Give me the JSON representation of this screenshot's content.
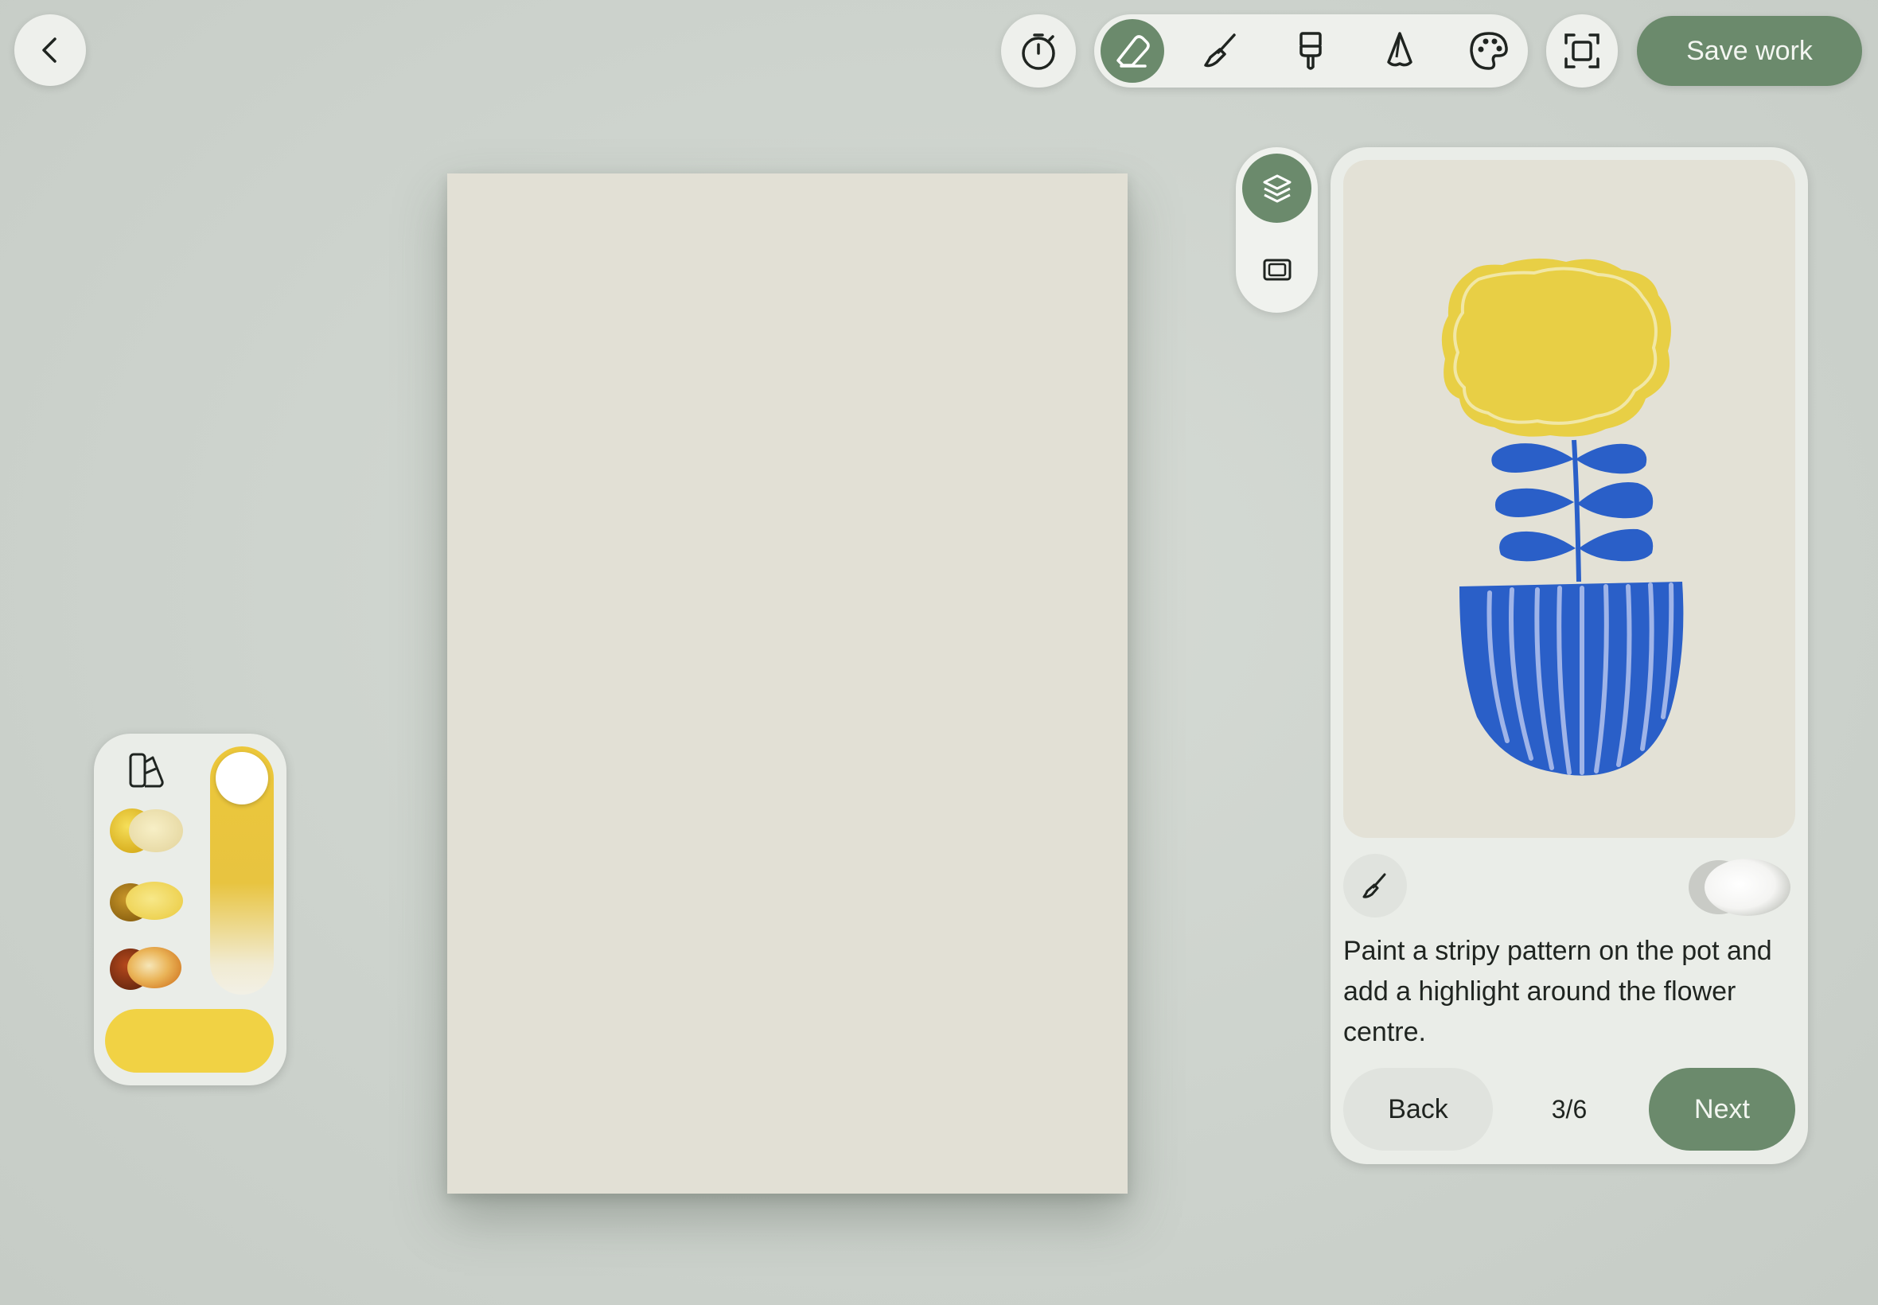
{
  "header": {
    "save_label": "Save work",
    "tools": [
      {
        "name": "eraser",
        "active": true
      },
      {
        "name": "brush"
      },
      {
        "name": "flat-brush"
      },
      {
        "name": "pencil"
      },
      {
        "name": "palette"
      }
    ]
  },
  "guide": {
    "instruction": "Paint a stripy pattern on the pot and add a highlight around the flower centre.",
    "back_label": "Back",
    "next_label": "Next",
    "step": "3/6"
  },
  "palette": {
    "current_color": "#f1d244",
    "opacity": 1.0,
    "swatches": [
      "yellow-cream",
      "ochre-yellow",
      "rust-orange"
    ]
  },
  "colors": {
    "accent": "#6b8a6c",
    "canvas": "#e2e0d5",
    "flower_yellow": "#e8cf45",
    "pot_blue": "#2a5fc8"
  }
}
